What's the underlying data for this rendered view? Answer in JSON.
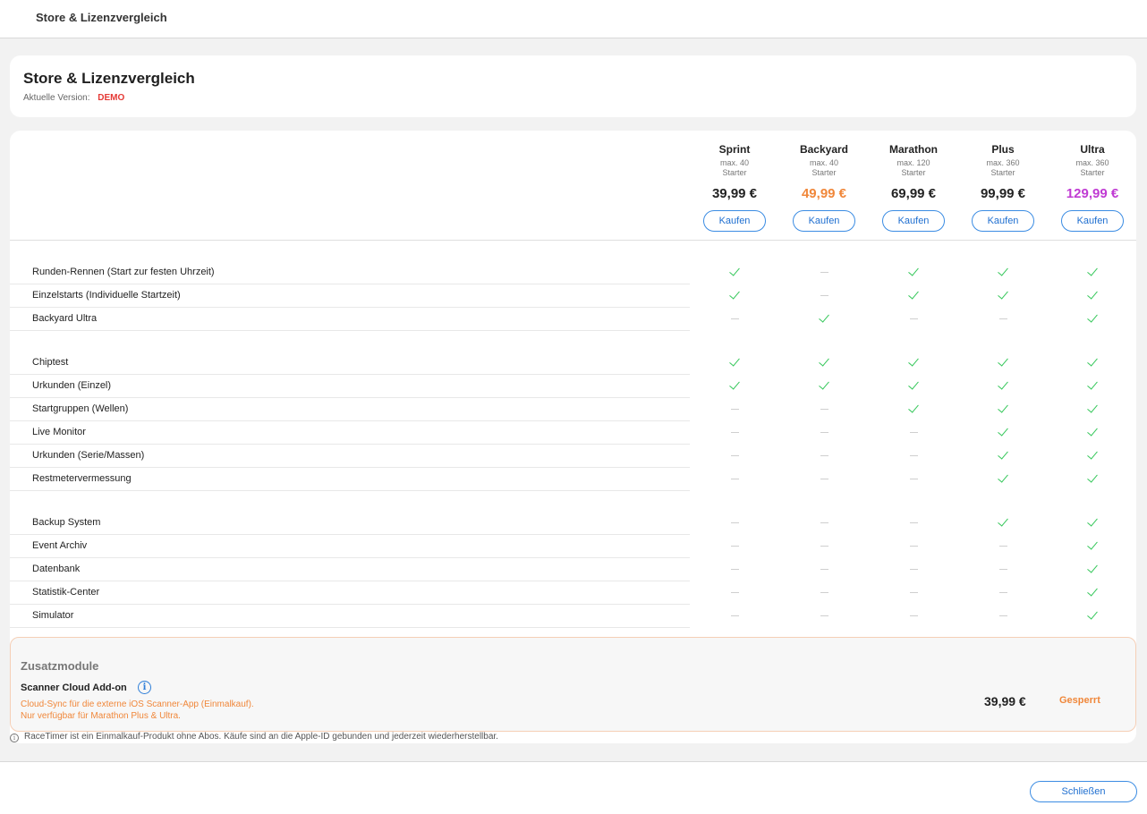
{
  "window": {
    "title": "Store & Lizenzvergleich"
  },
  "header": {
    "title": "Store & Lizenzvergleich",
    "version_label": "Aktuelle Version:",
    "version_value": "DEMO"
  },
  "plans": [
    {
      "name": "Sprint",
      "max_line1": "max. 40",
      "max_line2": "Starter",
      "price": "39,99 €",
      "price_color": "#222222",
      "buy_label": "Kaufen"
    },
    {
      "name": "Backyard",
      "max_line1": "max. 40",
      "max_line2": "Starter",
      "price": "49,99 €",
      "price_color": "#f0873a",
      "buy_label": "Kaufen"
    },
    {
      "name": "Marathon",
      "max_line1": "max. 120",
      "max_line2": "Starter",
      "price": "69,99 €",
      "price_color": "#222222",
      "buy_label": "Kaufen"
    },
    {
      "name": "Plus",
      "max_line1": "max. 360",
      "max_line2": "Starter",
      "price": "99,99 €",
      "price_color": "#222222",
      "buy_label": "Kaufen"
    },
    {
      "name": "Ultra",
      "max_line1": "max. 360",
      "max_line2": "Starter",
      "price": "129,99 €",
      "price_color": "#c03bd3",
      "buy_label": "Kaufen"
    }
  ],
  "feature_groups": [
    {
      "features": [
        {
          "label": "Runden-Rennen (Start zur festen Uhrzeit)",
          "availability": [
            true,
            false,
            true,
            true,
            true
          ]
        },
        {
          "label": "Einzelstarts (Individuelle Startzeit)",
          "availability": [
            true,
            false,
            true,
            true,
            true
          ]
        },
        {
          "label": "Backyard Ultra",
          "availability": [
            false,
            true,
            false,
            false,
            true
          ]
        }
      ]
    },
    {
      "features": [
        {
          "label": "Chiptest",
          "availability": [
            true,
            true,
            true,
            true,
            true
          ]
        },
        {
          "label": "Urkunden (Einzel)",
          "availability": [
            true,
            true,
            true,
            true,
            true
          ]
        },
        {
          "label": "Startgruppen (Wellen)",
          "availability": [
            false,
            false,
            true,
            true,
            true
          ]
        },
        {
          "label": "Live Monitor",
          "availability": [
            false,
            false,
            false,
            true,
            true
          ]
        },
        {
          "label": "Urkunden (Serie/Massen)",
          "availability": [
            false,
            false,
            false,
            true,
            true
          ]
        },
        {
          "label": "Restmetervermessung",
          "availability": [
            false,
            false,
            false,
            true,
            true
          ]
        }
      ]
    },
    {
      "features": [
        {
          "label": "Backup System",
          "availability": [
            false,
            false,
            false,
            true,
            true
          ]
        },
        {
          "label": "Event Archiv",
          "availability": [
            false,
            false,
            false,
            false,
            true
          ]
        },
        {
          "label": "Datenbank",
          "availability": [
            false,
            false,
            false,
            false,
            true
          ]
        },
        {
          "label": "Statistik-Center",
          "availability": [
            false,
            false,
            false,
            false,
            true
          ]
        },
        {
          "label": "Simulator",
          "availability": [
            false,
            false,
            false,
            false,
            true
          ]
        }
      ]
    }
  ],
  "addons": {
    "section_title": "Zusatzmodule",
    "name": "Scanner Cloud Add-on",
    "info_icon": "info-icon",
    "description_line1": "Cloud-Sync für die externe iOS Scanner-App (Einmalkauf).",
    "description_line2": "Nur verfügbar für Marathon Plus & Ultra.",
    "price": "39,99 €",
    "status": "Gesperrt"
  },
  "footnote": {
    "icon": "info-icon",
    "text": "RaceTimer ist ein Einmalkauf-Produkt ohne Abos. Käufe sind an die Apple-ID gebunden und jederzeit wiederherstellbar."
  },
  "footer": {
    "close_label": "Schließen"
  },
  "colors": {
    "accent": "#3b8ce3",
    "check": "#34c759",
    "warning": "#f0873a",
    "demo": "#e53935"
  }
}
